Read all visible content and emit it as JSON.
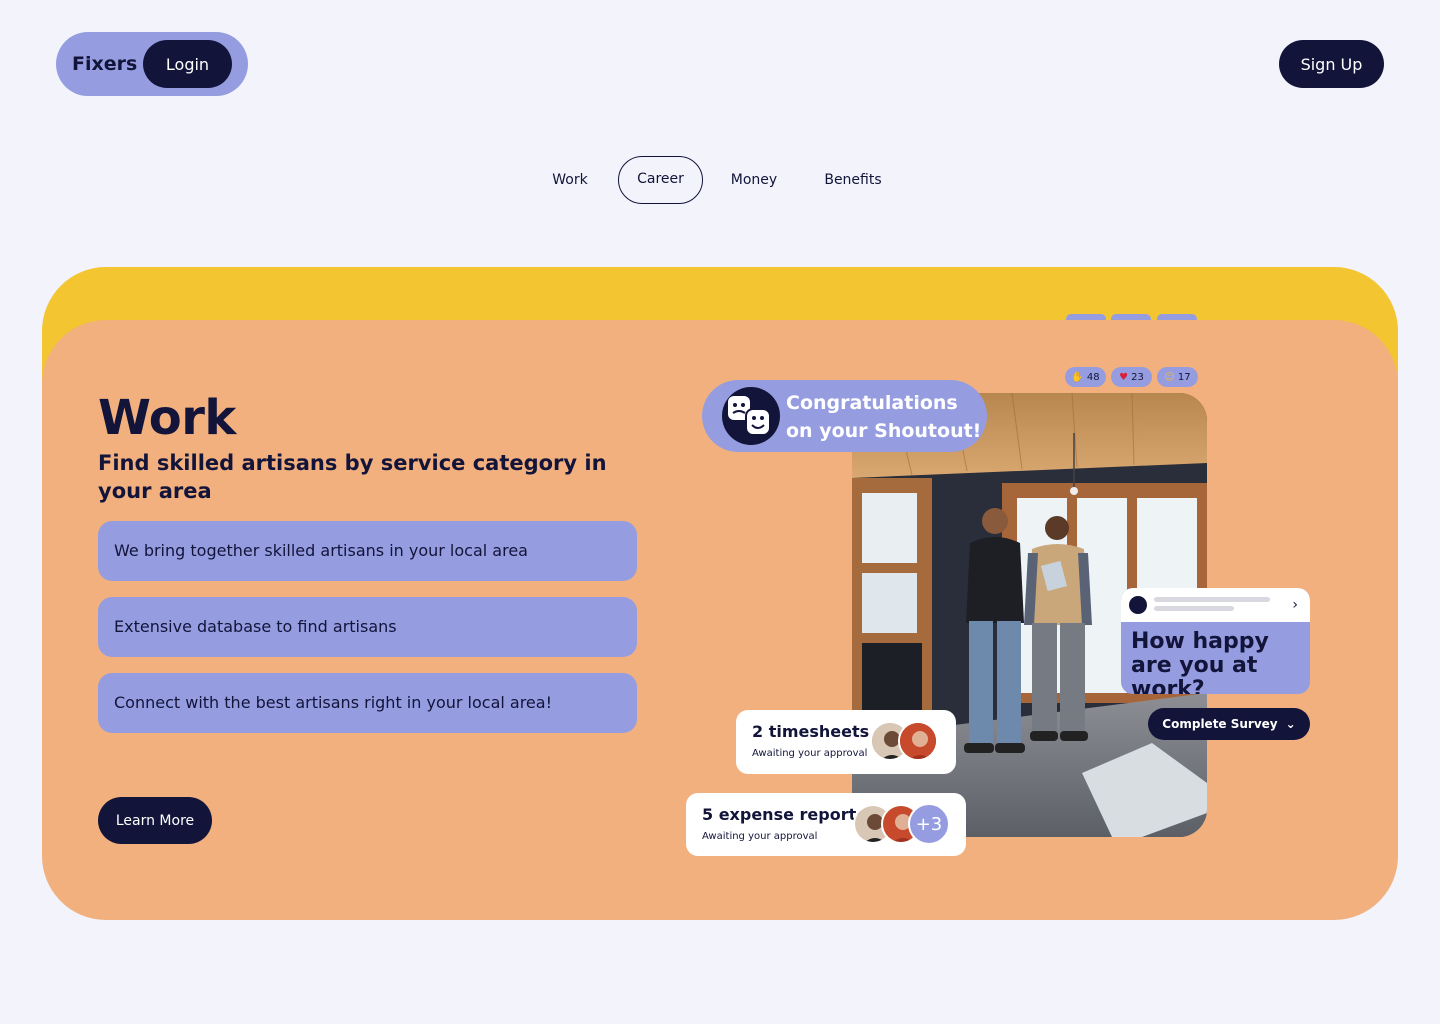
{
  "header": {
    "brand": "Fixers",
    "login_label": "Login",
    "signup_label": "Sign Up"
  },
  "tabs": [
    {
      "label": "Work",
      "active": false
    },
    {
      "label": "Career",
      "active": true
    },
    {
      "label": "Money",
      "active": false
    },
    {
      "label": "Benefits",
      "active": false
    }
  ],
  "hero": {
    "title": "Work",
    "subtitle": "Find skilled artisans by service category in your area",
    "features": [
      "We bring together skilled artisans in your local area",
      "Extensive database to find artisans",
      "Connect with the best artisans right in your local area!"
    ],
    "cta_label": "Learn More"
  },
  "reactions": [
    {
      "icon": "clap-icon",
      "count": "48"
    },
    {
      "icon": "heart-icon",
      "count": "23"
    },
    {
      "icon": "laugh-icon",
      "count": "17"
    }
  ],
  "shoutout": {
    "text": "Congratulations on your Shoutout!",
    "icon": "masks-icon"
  },
  "survey": {
    "question": "How happy are you at work?",
    "button_label": "Complete Survey"
  },
  "approvals": [
    {
      "title": "2 timesheets",
      "subtitle": "Awaiting your approval"
    },
    {
      "title": "5 expense reports",
      "subtitle": "Awaiting your approval",
      "more": "+3"
    }
  ],
  "colors": {
    "background": "#f2f3fb",
    "navy": "#12143a",
    "lavender": "#959de0",
    "yellow": "#f2c531",
    "peach": "#f2b07e"
  }
}
